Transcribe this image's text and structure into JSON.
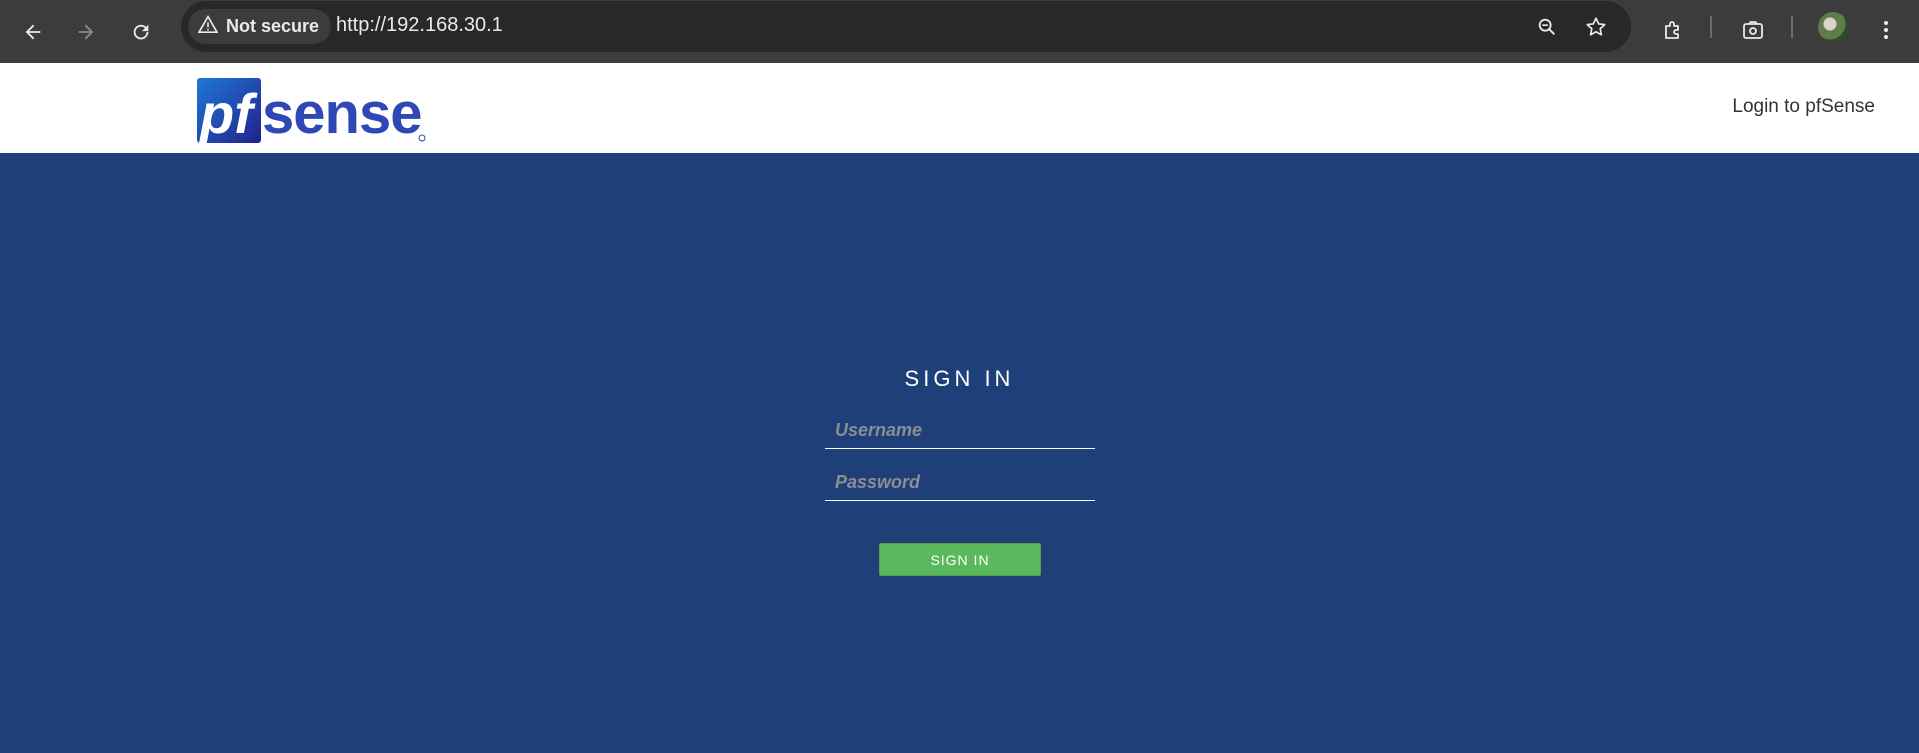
{
  "browser": {
    "security_label": "Not secure",
    "url": "http://192.168.30.1"
  },
  "header": {
    "logo_text": "pfsense",
    "page_title": "Login to pfSense"
  },
  "form": {
    "heading": "SIGN IN",
    "username_placeholder": "Username",
    "password_placeholder": "Password",
    "submit_label": "SIGN IN"
  },
  "colors": {
    "page_background": "#1e3f77",
    "button": "#5cb85c",
    "logo_blue": "#2f48b5"
  }
}
